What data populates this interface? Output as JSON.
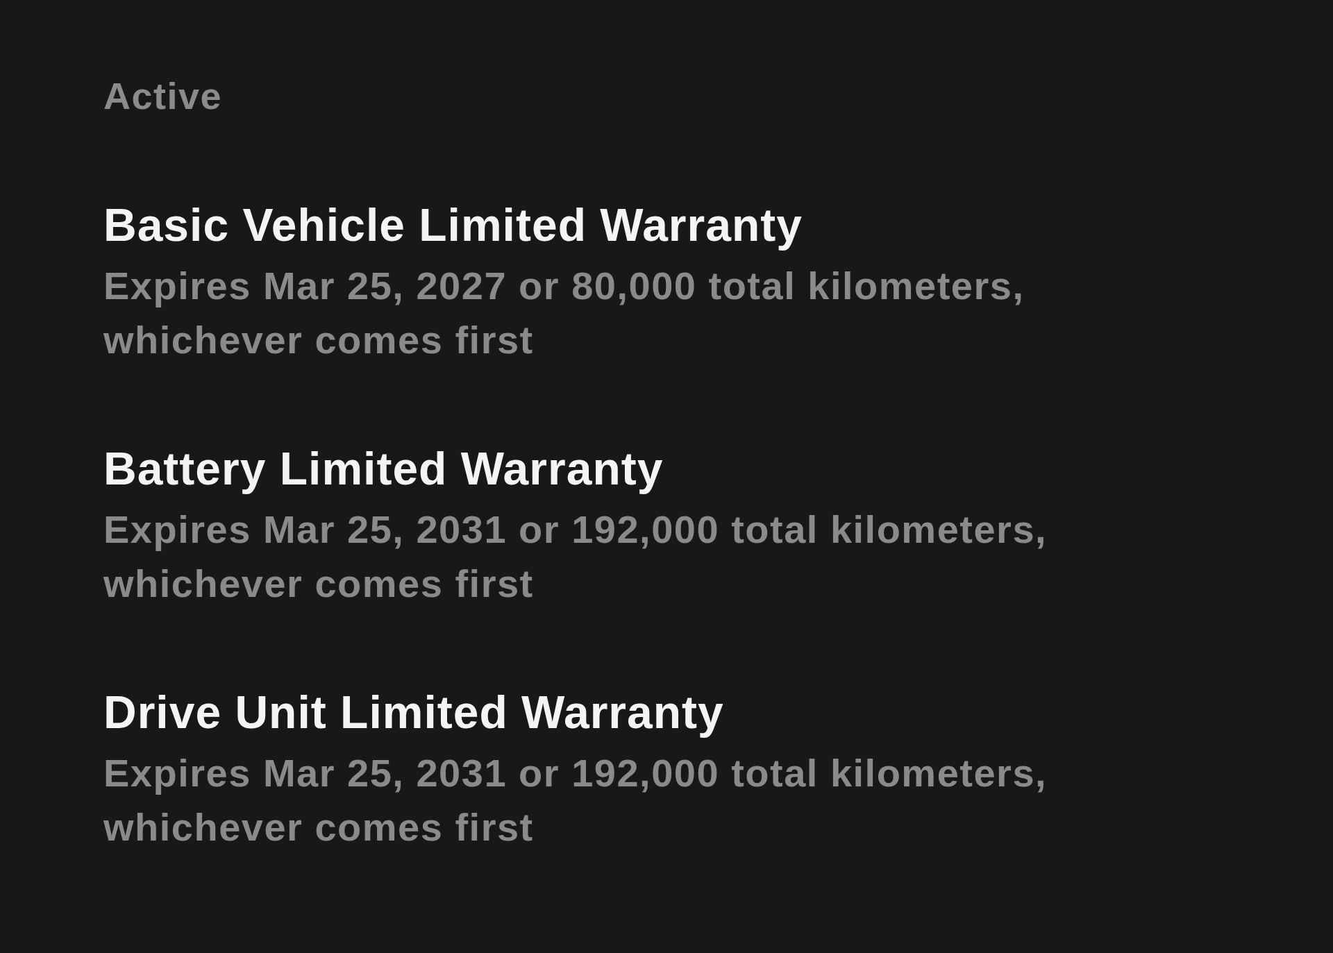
{
  "section_title": "Active",
  "warranties": [
    {
      "title": "Basic Vehicle Limited Warranty",
      "details": "Expires Mar 25, 2027 or 80,000 total kilometers, whichever comes first"
    },
    {
      "title": "Battery Limited Warranty",
      "details": "Expires Mar 25, 2031 or 192,000 total kilometers, whichever comes first"
    },
    {
      "title": "Drive Unit Limited Warranty",
      "details": "Expires Mar 25, 2031 or 192,000 total kilometers, whichever comes first"
    }
  ]
}
